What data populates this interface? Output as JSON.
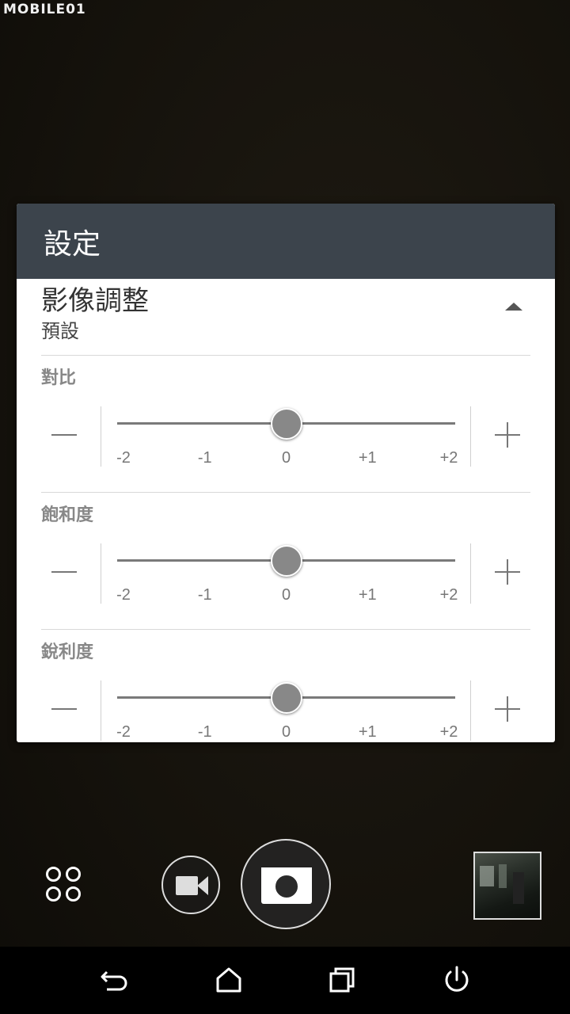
{
  "watermark": "MOBILE01",
  "dialog": {
    "title": "設定",
    "section": {
      "title": "影像調整",
      "value": "預設"
    },
    "settings": [
      {
        "label": "對比",
        "value": 0,
        "ticks": [
          "-2",
          "-1",
          "0",
          "+1",
          "+2"
        ]
      },
      {
        "label": "飽和度",
        "value": 0,
        "ticks": [
          "-2",
          "-1",
          "0",
          "+1",
          "+2"
        ]
      },
      {
        "label": "銳利度",
        "value": 0,
        "ticks": [
          "-2",
          "-1",
          "0",
          "+1",
          "+2"
        ]
      }
    ]
  },
  "camera": {
    "icons": [
      "modes-icon",
      "video-icon",
      "camera-icon"
    ]
  },
  "navbar": {
    "icons": [
      "back-icon",
      "home-icon",
      "recents-icon",
      "power-icon"
    ]
  }
}
